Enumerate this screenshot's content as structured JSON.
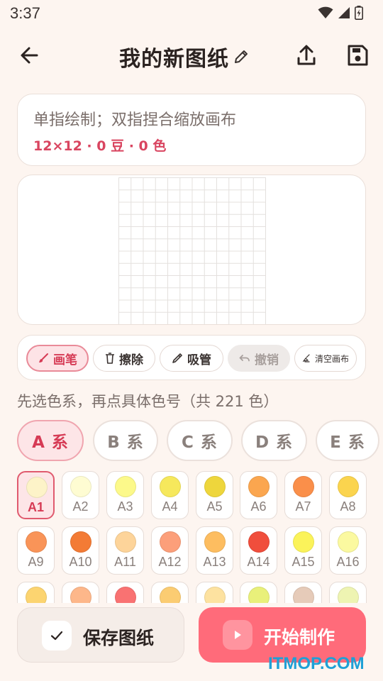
{
  "status": {
    "time": "3:37"
  },
  "app_bar": {
    "title": "我的新图纸"
  },
  "hint_card": {
    "hint": "单指绘制；双指捏合缩放画布",
    "grid_info": "12×12 · 0 豆 · 0 色"
  },
  "canvas": {
    "rows": 12,
    "cols": 12
  },
  "toolbar": {
    "brush": "画笔",
    "eraser": "擦除",
    "eyedropper": "吸管",
    "undo": "撤销",
    "clear": "清空画布"
  },
  "palette": {
    "hint": "先选色系，再点具体色号（共 221 色）",
    "series": [
      "A 系",
      "B 系",
      "C 系",
      "D 系",
      "E 系"
    ],
    "active_series": "A 系",
    "active_swatch": "A1",
    "swatches": [
      {
        "code": "A1",
        "color": "#fdf3c8"
      },
      {
        "code": "A2",
        "color": "#fefcd2"
      },
      {
        "code": "A3",
        "color": "#fcf98a"
      },
      {
        "code": "A4",
        "color": "#f6e85c"
      },
      {
        "code": "A5",
        "color": "#eed63c"
      },
      {
        "code": "A6",
        "color": "#fba64f"
      },
      {
        "code": "A7",
        "color": "#fa8f4a"
      },
      {
        "code": "A8",
        "color": "#fbd44e"
      },
      {
        "code": "A9",
        "color": "#f99458"
      },
      {
        "code": "A10",
        "color": "#f37b35"
      },
      {
        "code": "A11",
        "color": "#fdd49a"
      },
      {
        "code": "A12",
        "color": "#fc9f7a"
      },
      {
        "code": "A13",
        "color": "#fdbd60"
      },
      {
        "code": "A14",
        "color": "#f04e3c"
      },
      {
        "code": "A15",
        "color": "#fbf35a"
      },
      {
        "code": "A16",
        "color": "#fbf9a0"
      },
      {
        "code": "",
        "color": "#fcd470"
      },
      {
        "code": "",
        "color": "#fdb78a"
      },
      {
        "code": "",
        "color": "#f97272"
      },
      {
        "code": "",
        "color": "#fbcc72"
      },
      {
        "code": "",
        "color": "#fde2a0"
      },
      {
        "code": "",
        "color": "#e9f07a"
      },
      {
        "code": "",
        "color": "#e6cbb9"
      },
      {
        "code": "",
        "color": "#eef4b2"
      }
    ]
  },
  "bottom": {
    "save": "保存图纸",
    "start": "开始制作"
  },
  "watermark": "ITMOP.COM",
  "colors": {
    "accent": "#ff6b7a",
    "accent_text": "#d63b55",
    "background": "#fdf5f0"
  }
}
